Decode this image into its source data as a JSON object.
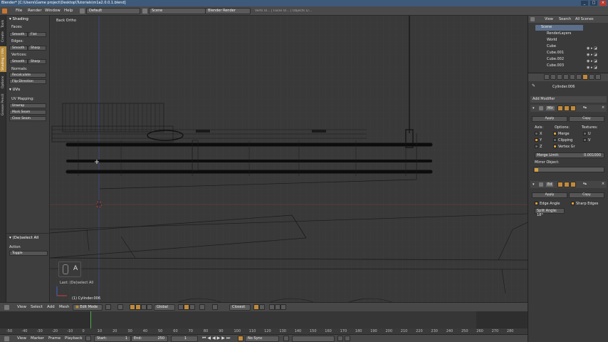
{
  "window": {
    "title": "Blender* [C:\\Users\\Game project\\Desktop\\Tutorials\\m1a2.0.0.1.blend]",
    "minimize": "_",
    "maximize": "□",
    "close": "×"
  },
  "info_header": {
    "menus": [
      "File",
      "Render",
      "Window",
      "Help"
    ],
    "layout": "Default",
    "scene": "Scene",
    "engine": "Blender Render",
    "stats": "Verts 0/... | Faces 0/... | Objects 1/..."
  },
  "tool_tabs": [
    "Tools",
    "Create",
    "Shading / UVs",
    "Options",
    "Grease Pencil"
  ],
  "shelf": {
    "shading_header": "Shading",
    "faces_label": "Faces:",
    "faces_buttons": [
      "Smooth",
      "Flat"
    ],
    "edges_label": "Edges:",
    "edges_buttons": [
      "Smooth",
      "Sharp"
    ],
    "vertices_label": "Vertices:",
    "vertices_buttons": [
      "Smooth",
      "Sharp"
    ],
    "normals_label": "Normals:",
    "recalculate": "Recalculate",
    "flip_direction": "Flip Direction",
    "uvs_header": "UVs",
    "uv_mapping_label": "UV Mapping:",
    "unwrap": "Unwrap",
    "mark_seam": "Mark Seam",
    "clear_seam": "Clear Seam",
    "last_op_header": "(De)select All",
    "action_label": "Action",
    "action_value": "Toggle"
  },
  "viewport": {
    "view_name": "Back Ortho",
    "key_hint": "A",
    "last_op": "Last: (De)select All",
    "object_label": "(1) Cylinder.006"
  },
  "outliner": {
    "tabs": [
      "View",
      "Search",
      "All Scenes"
    ],
    "items": [
      "Scene",
      "RenderLayers",
      "World",
      "Cube",
      "Cube.001",
      "Cube.002",
      "Cube.003"
    ]
  },
  "properties": {
    "object_name": "Cylinder.006",
    "add_modifier": "Add Modifier",
    "mirror": {
      "name": "Mir",
      "apply": "Apply",
      "copy": "Copy",
      "axis_label": "Axis:",
      "options_label": "Options:",
      "textures_label": "Textures:",
      "x": "X",
      "y": "Y",
      "z": "Z",
      "merge": "Merge",
      "clipping": "Clipping",
      "vertex_gr": "Vertex Gr",
      "u": "U",
      "v": "V",
      "merge_limit_label": "Merge Limit:",
      "merge_limit_value": "0.001000",
      "mirror_object_label": "Mirror Object:"
    },
    "edge_split": {
      "name": "Ed",
      "apply": "Apply",
      "copy": "Copy",
      "edge_angle": "Edge Angle",
      "sharp_edges": "Sharp Edges",
      "split_angle": "Split Angle: 18°"
    }
  },
  "v3d_header": {
    "menus": [
      "View",
      "Select",
      "Add",
      "Mesh"
    ],
    "mode": "Edit Mode",
    "orientation": "Global",
    "proportional": "Closest"
  },
  "timeline": {
    "ticks": [
      "-50",
      "-40",
      "-30",
      "-20",
      "-10",
      "0",
      "10",
      "20",
      "30",
      "40",
      "50",
      "60",
      "70",
      "80",
      "90",
      "100",
      "110",
      "120",
      "130",
      "140",
      "150",
      "160",
      "170",
      "180",
      "190",
      "200",
      "210",
      "220",
      "230",
      "240",
      "250",
      "260",
      "270",
      "280"
    ],
    "current_frame": "1"
  },
  "timeline_header": {
    "menus": [
      "View",
      "Marker",
      "Frame",
      "Playback"
    ],
    "start_label": "Start:",
    "start_value": "1",
    "end_label": "End:",
    "end_value": "250",
    "frame_value": "1",
    "sync": "No Sync"
  },
  "colors": {
    "accent": "#d8a03a",
    "selection": "#5c6f8a",
    "frame_marker": "#4caf50",
    "title_bar": "#3d5a7a"
  }
}
